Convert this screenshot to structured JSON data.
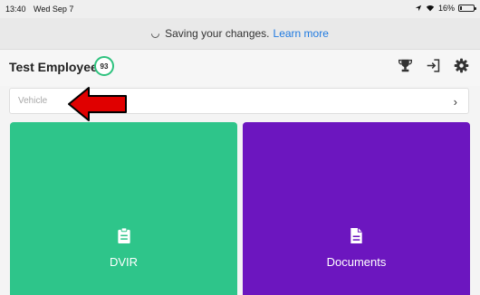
{
  "status_bar": {
    "time": "13:40",
    "date": "Wed Sep 7",
    "battery": "16%",
    "battery_level": 0.16
  },
  "banner": {
    "message": "Saving your changes.",
    "link": "Learn more"
  },
  "header": {
    "employee_name": "Test Employee",
    "score": "93"
  },
  "vehicle": {
    "placeholder": "Vehicle",
    "chevron": "›"
  },
  "tiles": [
    {
      "label": "DVIR",
      "color": "#2ec58a",
      "icon": "clipboard-icon"
    },
    {
      "label": "Documents",
      "color": "#6c16bf",
      "icon": "document-icon"
    }
  ],
  "colors": {
    "accent": "#1f7ae0",
    "score_ring": "#2ec27e",
    "annotation_arrow": "#e00000"
  }
}
